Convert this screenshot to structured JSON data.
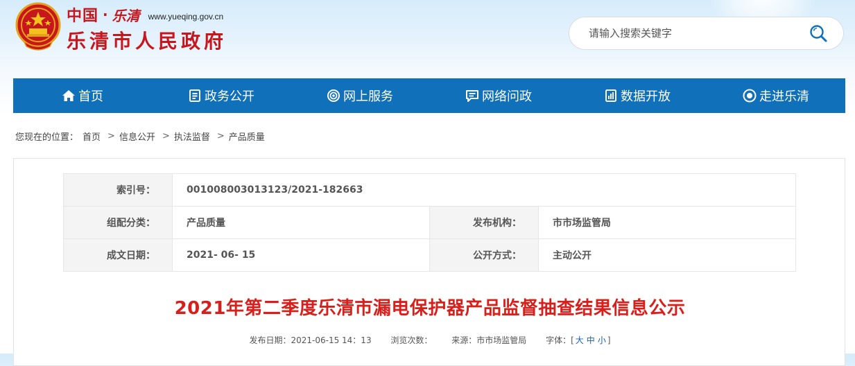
{
  "header": {
    "brand_cn": "中国",
    "brand_sep": "·",
    "brand_script": "乐清",
    "brand_url": "www.yueqing.gov.cn",
    "site_name": "乐清市人民政府"
  },
  "search": {
    "placeholder": "请输入搜索关键字"
  },
  "nav": {
    "items": [
      {
        "label": "首页",
        "icon": "home-icon"
      },
      {
        "label": "政务公开",
        "icon": "document-icon"
      },
      {
        "label": "网上服务",
        "icon": "service-icon"
      },
      {
        "label": "网络问政",
        "icon": "chat-icon"
      },
      {
        "label": "数据开放",
        "icon": "data-icon"
      },
      {
        "label": "走进乐清",
        "icon": "eye-icon"
      }
    ]
  },
  "breadcrumb": {
    "prefix": "您现在的位置：",
    "items": [
      "首页",
      "信息公开",
      "执法监督",
      "产品质量"
    ],
    "separator": ">"
  },
  "meta": {
    "index_label": "索引号：",
    "index_value": "001008003013123/2021-182663",
    "category_label": "组配分类：",
    "category_value": "产品质量",
    "publisher_label": "发布机构：",
    "publisher_value": "市市场监管局",
    "date_label": "成文日期：",
    "date_value": "2021- 06- 15",
    "mode_label": "公开方式：",
    "mode_value": "主动公开"
  },
  "article": {
    "title": "2021年第二季度乐清市漏电保护器产品监督抽查结果信息公示",
    "publish_time": "发布日期：2021-06-15 14：13",
    "views": "浏览次数：",
    "source": "来源：市市场监管局",
    "font_label": "字体：[",
    "font_large": "大",
    "font_medium": "中",
    "font_small": "小",
    "font_close": "]"
  },
  "colors": {
    "accent": "#1070ba",
    "title_red": "#d7201b",
    "brand_red": "#c8161d"
  }
}
